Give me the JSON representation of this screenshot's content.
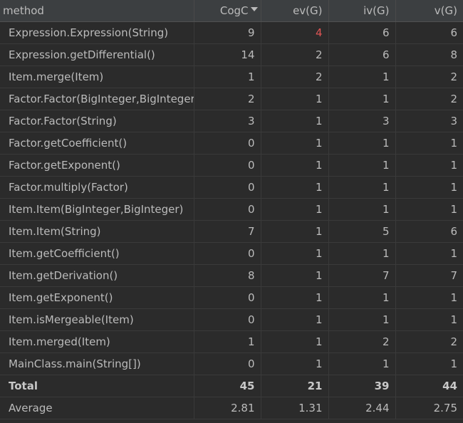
{
  "headers": {
    "method": "method",
    "cogc": "CogC",
    "ev": "ev(G)",
    "iv": "iv(G)",
    "v": "v(G)"
  },
  "sort_icon": "sort-descending-icon",
  "highlight_color": "#e05555",
  "rows": [
    {
      "method": "Expression.Expression(String)",
      "cogc": "9",
      "ev": "4",
      "iv": "6",
      "v": "6"
    },
    {
      "method": "Expression.getDifferential()",
      "cogc": "14",
      "ev": "2",
      "iv": "6",
      "v": "8"
    },
    {
      "method": "Item.merge(Item)",
      "cogc": "1",
      "ev": "2",
      "iv": "1",
      "v": "2"
    },
    {
      "method": "Factor.Factor(BigInteger,BigInteger)",
      "cogc": "2",
      "ev": "1",
      "iv": "1",
      "v": "2"
    },
    {
      "method": "Factor.Factor(String)",
      "cogc": "3",
      "ev": "1",
      "iv": "3",
      "v": "3"
    },
    {
      "method": "Factor.getCoefficient()",
      "cogc": "0",
      "ev": "1",
      "iv": "1",
      "v": "1"
    },
    {
      "method": "Factor.getExponent()",
      "cogc": "0",
      "ev": "1",
      "iv": "1",
      "v": "1"
    },
    {
      "method": "Factor.multiply(Factor)",
      "cogc": "0",
      "ev": "1",
      "iv": "1",
      "v": "1"
    },
    {
      "method": "Item.Item(BigInteger,BigInteger)",
      "cogc": "0",
      "ev": "1",
      "iv": "1",
      "v": "1"
    },
    {
      "method": "Item.Item(String)",
      "cogc": "7",
      "ev": "1",
      "iv": "5",
      "v": "6"
    },
    {
      "method": "Item.getCoefficient()",
      "cogc": "0",
      "ev": "1",
      "iv": "1",
      "v": "1"
    },
    {
      "method": "Item.getDerivation()",
      "cogc": "8",
      "ev": "1",
      "iv": "7",
      "v": "7"
    },
    {
      "method": "Item.getExponent()",
      "cogc": "0",
      "ev": "1",
      "iv": "1",
      "v": "1"
    },
    {
      "method": "Item.isMergeable(Item)",
      "cogc": "0",
      "ev": "1",
      "iv": "1",
      "v": "1"
    },
    {
      "method": "Item.merged(Item)",
      "cogc": "1",
      "ev": "1",
      "iv": "2",
      "v": "2"
    },
    {
      "method": "MainClass.main(String[])",
      "cogc": "0",
      "ev": "1",
      "iv": "1",
      "v": "1"
    }
  ],
  "total": {
    "label": "Total",
    "cogc": "45",
    "ev": "21",
    "iv": "39",
    "v": "44"
  },
  "average": {
    "label": "Average",
    "cogc": "2.81",
    "ev": "1.31",
    "iv": "2.44",
    "v": "2.75"
  }
}
